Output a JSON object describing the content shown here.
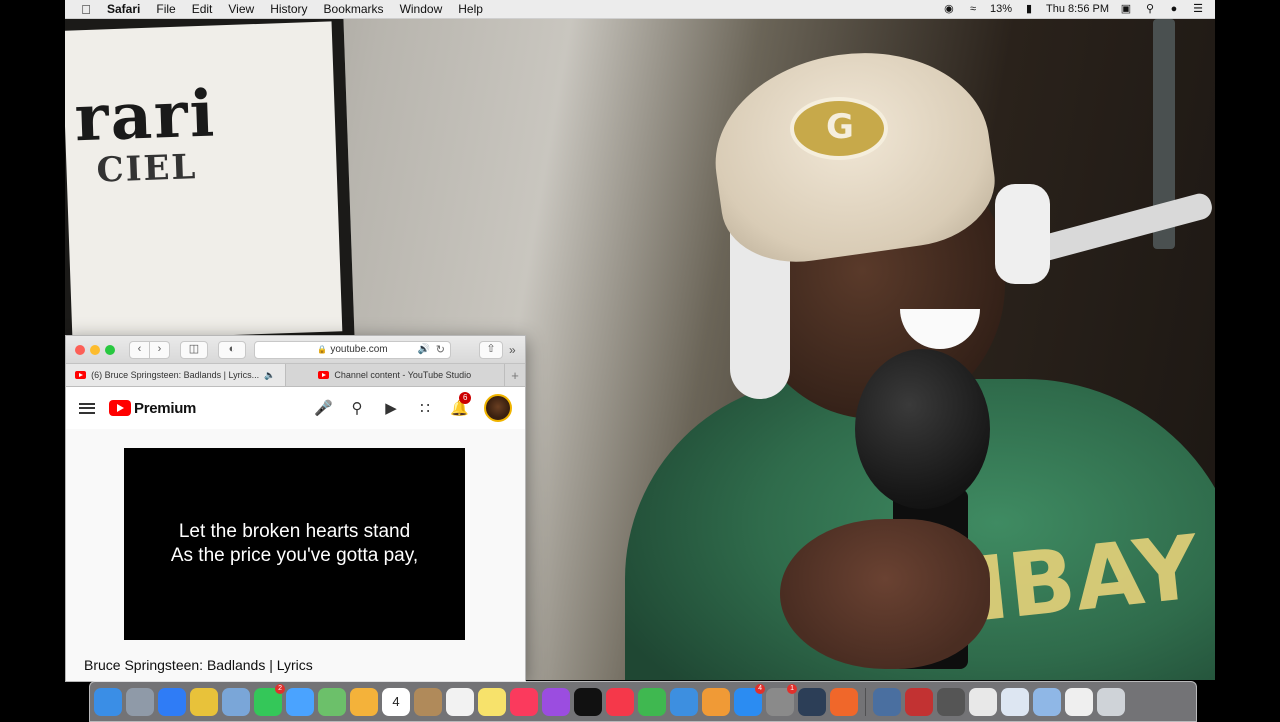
{
  "menubar": {
    "app": "Safari",
    "menus": [
      "File",
      "Edit",
      "View",
      "History",
      "Bookmarks",
      "Window",
      "Help"
    ],
    "battery": "13%",
    "clock": "Thu 8:56 PM"
  },
  "browser": {
    "url": "youtube.com",
    "tabs": [
      {
        "title": "(6) Bruce Springsteen: Badlands | Lyrics..."
      },
      {
        "title": "Channel content - YouTube Studio"
      }
    ]
  },
  "youtube": {
    "logo": "Premium",
    "notification_count": "6",
    "lyrics": [
      "Let the broken hearts stand",
      "As the price you've gotta pay,"
    ],
    "video_title": "Bruce Springsteen: Badlands | Lyrics"
  },
  "dock": {
    "calendar_day": "4",
    "apps": [
      {
        "name": "finder",
        "color": "#3a8ee6"
      },
      {
        "name": "launchpad",
        "color": "#8f9aa8"
      },
      {
        "name": "safari",
        "color": "#2f7cf6"
      },
      {
        "name": "chrome",
        "color": "#e8c23a"
      },
      {
        "name": "preview",
        "color": "#7aa6d8"
      },
      {
        "name": "facetime",
        "color": "#34c759",
        "badge": "2"
      },
      {
        "name": "messages",
        "color": "#4aa3ff"
      },
      {
        "name": "maps",
        "color": "#6cc06a"
      },
      {
        "name": "photos",
        "color": "#f4b23a"
      },
      {
        "name": "calendar",
        "color": "#ffffff"
      },
      {
        "name": "notes-brown",
        "color": "#b08a5a"
      },
      {
        "name": "reminders",
        "color": "#f2f2f2"
      },
      {
        "name": "stickies",
        "color": "#f7e26b"
      },
      {
        "name": "music",
        "color": "#fb3a5d"
      },
      {
        "name": "podcasts",
        "color": "#9b4de0"
      },
      {
        "name": "tv",
        "color": "#111111"
      },
      {
        "name": "news",
        "color": "#f5384a"
      },
      {
        "name": "numbers",
        "color": "#3fb850"
      },
      {
        "name": "keynote",
        "color": "#3d8fe0"
      },
      {
        "name": "pages",
        "color": "#f09a36"
      },
      {
        "name": "app-store",
        "color": "#2b8cf2",
        "badge": "4"
      },
      {
        "name": "system-preferences",
        "color": "#8a8a8a",
        "badge": "1"
      },
      {
        "name": "quicktime",
        "color": "#2c3e57"
      },
      {
        "name": "screen-recorder",
        "color": "#f0672a"
      }
    ],
    "extras": [
      {
        "name": "photo-booth",
        "color": "#4a6fa0"
      },
      {
        "name": "collage",
        "color": "#c23232"
      },
      {
        "name": "calculator",
        "color": "#555555"
      },
      {
        "name": "document",
        "color": "#e8e8e8"
      },
      {
        "name": "document-2",
        "color": "#dde6f2"
      },
      {
        "name": "folder",
        "color": "#8fb7e6"
      },
      {
        "name": "document-3",
        "color": "#efefef"
      },
      {
        "name": "trash",
        "color": "#cfd3d8"
      }
    ]
  },
  "colors": {
    "youtube_red": "#ff0000",
    "safari_blue": "#2f7cf6"
  }
}
